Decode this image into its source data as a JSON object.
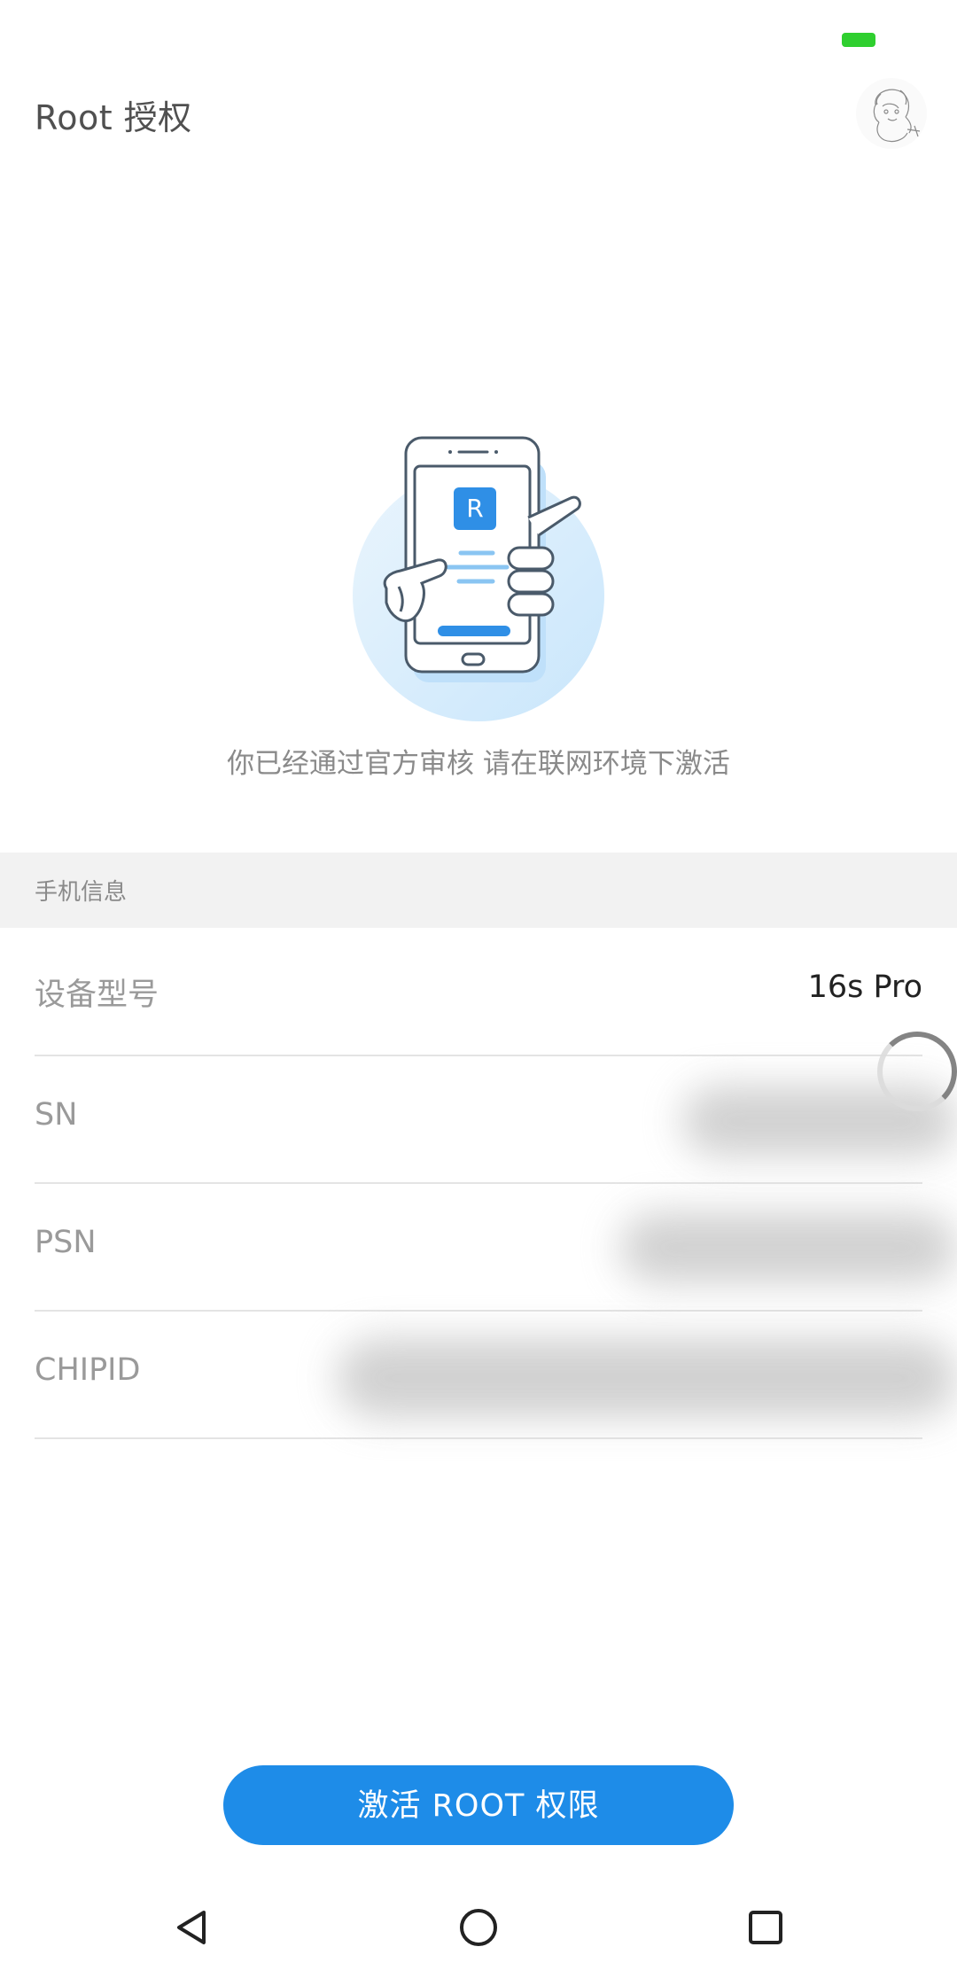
{
  "status": {
    "battery_color": "#2fcf2f"
  },
  "header": {
    "title": "Root 授权",
    "avatar_icon": "avatar-sketch"
  },
  "hero": {
    "illustration_icon": "phone-in-hand-icon",
    "badge_letter": "R",
    "hint": "你已经通过官方审核 请在联网环境下激活"
  },
  "section": {
    "title": "手机信息"
  },
  "info": {
    "rows": [
      {
        "label": "设备型号",
        "value": "16s Pro"
      },
      {
        "label": "SN",
        "value": ""
      },
      {
        "label": "PSN",
        "value": ""
      },
      {
        "label": "CHIPID",
        "value": ""
      }
    ]
  },
  "actions": {
    "activate_label": "激活 ROOT 权限",
    "accent": "#1e8ce8"
  },
  "navbar": {
    "back_icon": "back-triangle-icon",
    "home_icon": "home-circle-icon",
    "recents_icon": "recents-square-icon"
  }
}
